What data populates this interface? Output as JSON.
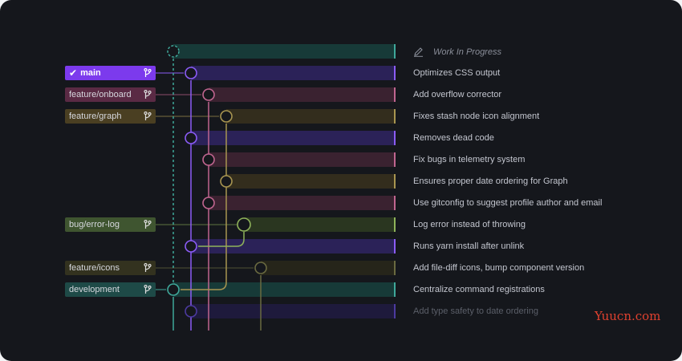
{
  "wip": {
    "label": "Work In Progress",
    "icon": "pencil-icon"
  },
  "branches": [
    {
      "id": "main",
      "label": "main",
      "checked": true,
      "icon": "branch-icon",
      "color": "#8b5cf6",
      "bg": "#7c3aed"
    },
    {
      "id": "feature-onboard",
      "label": "feature/onboard",
      "checked": false,
      "icon": "branch-icon",
      "color": "#c0658f",
      "bg": "#5a2a44"
    },
    {
      "id": "feature-graph",
      "label": "feature/graph",
      "checked": false,
      "icon": "branch-icon",
      "color": "#a89550",
      "bg": "#4a3f22"
    },
    {
      "id": "bug-error-log",
      "label": "bug/error-log",
      "checked": false,
      "icon": "branch-icon",
      "color": "#8fb35a",
      "bg": "#3f5530"
    },
    {
      "id": "feature-icons",
      "label": "feature/icons",
      "checked": false,
      "icon": "branch-icon",
      "color": "#6a6a40",
      "bg": "#33321f"
    },
    {
      "id": "development",
      "label": "development",
      "checked": false,
      "icon": "branch-icon",
      "color": "#3fa89a",
      "bg": "#1e4a47"
    }
  ],
  "commits": [
    {
      "message": "Optimizes CSS output"
    },
    {
      "message": "Add overflow corrector"
    },
    {
      "message": "Fixes stash node icon alignment"
    },
    {
      "message": "Removes dead code"
    },
    {
      "message": "Fix bugs in telemetry system"
    },
    {
      "message": "Ensures proper date ordering for Graph"
    },
    {
      "message": "Use gitconfig to suggest profile author and email"
    },
    {
      "message": "Log error instead of throwing"
    },
    {
      "message": "Runs yarn install after unlink"
    },
    {
      "message": "Add file-diff icons, bump component version"
    },
    {
      "message": "Centralize command registrations"
    },
    {
      "message": "Add type safety to date ordering"
    }
  ],
  "watermark": "Yuucn.com"
}
